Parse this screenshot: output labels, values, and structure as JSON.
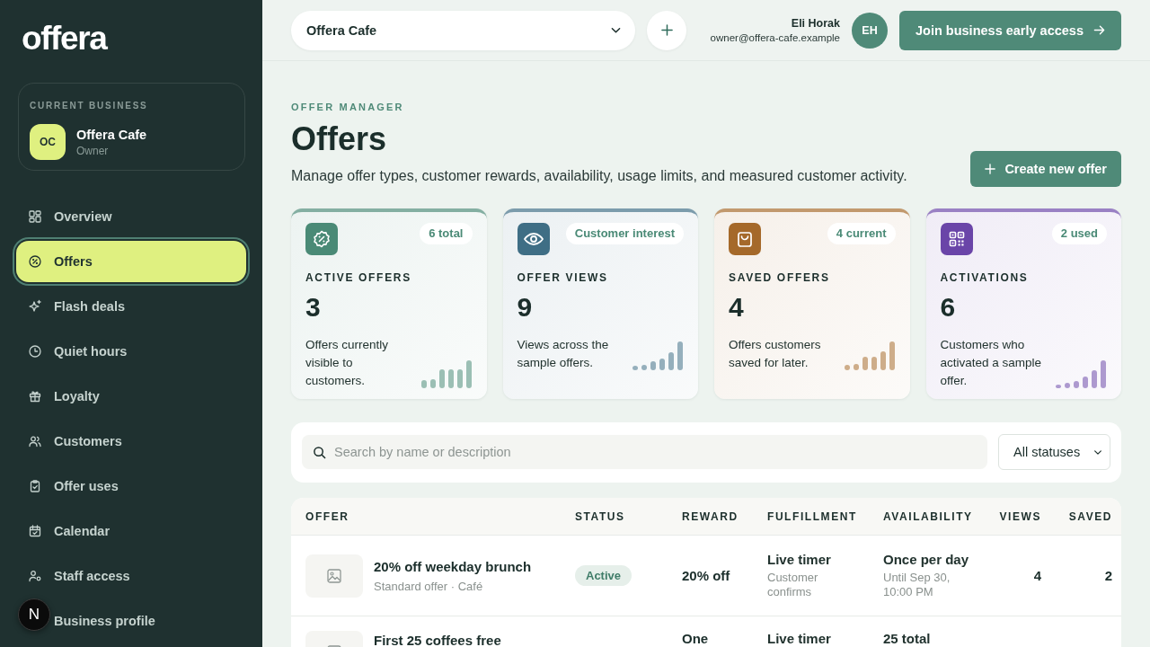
{
  "sidebar": {
    "logo": "offera",
    "business_card": {
      "caption": "CURRENT BUSINESS",
      "initials": "OC",
      "name": "Offera Cafe",
      "role": "Owner"
    },
    "nav": [
      {
        "label": "Overview",
        "selected": false
      },
      {
        "label": "Offers",
        "selected": true
      },
      {
        "label": "Flash deals",
        "selected": false
      },
      {
        "label": "Quiet hours",
        "selected": false
      },
      {
        "label": "Loyalty",
        "selected": false
      },
      {
        "label": "Customers",
        "selected": false
      },
      {
        "label": "Offer uses",
        "selected": false
      },
      {
        "label": "Calendar",
        "selected": false
      },
      {
        "label": "Staff access",
        "selected": false
      },
      {
        "label": "Business profile",
        "selected": false
      }
    ]
  },
  "dev_badge": {
    "label": "N"
  },
  "topbar": {
    "business_select": {
      "value": "Offera Cafe"
    },
    "user": {
      "name": "Eli Horak",
      "email": "owner@offera-cafe.example",
      "initials": "EH"
    },
    "cta": "Join business early access"
  },
  "header": {
    "eyebrow": "OFFER MANAGER",
    "title": "Offers",
    "description": "Manage offer types, customer rewards, availability, usage limits, and measured customer activity.",
    "create_button": "Create new offer"
  },
  "stats": [
    {
      "label": "ACTIVE OFFERS",
      "value": "3",
      "badge": "6 total",
      "description": "Offers currently visible to customers.",
      "color": "#4a8a76"
    },
    {
      "label": "OFFER VIEWS",
      "value": "9",
      "badge": "Customer interest",
      "description": "Views across the sample offers.",
      "color": "#3f6e85"
    },
    {
      "label": "SAVED OFFERS",
      "value": "4",
      "badge": "4 current",
      "description": "Offers customers saved for later.",
      "color": "#a5692a"
    },
    {
      "label": "ACTIVATIONS",
      "value": "6",
      "badge": "2 used",
      "description": "Customers who activated a sample offer.",
      "color": "#6a45a8"
    }
  ],
  "filters": {
    "search": {
      "placeholder": "Search by name or description"
    },
    "status_select": {
      "value": "All statuses"
    }
  },
  "table": {
    "columns": [
      "OFFER",
      "STATUS",
      "REWARD",
      "FULFILLMENT",
      "AVAILABILITY",
      "VIEWS",
      "SAVED"
    ],
    "rows": [
      {
        "title": "20% off weekday brunch",
        "subtitle": "Standard offer · Café",
        "status": "Active",
        "reward": "20% off",
        "fulfillment": "Live timer",
        "fulfillment_note": "Customer confirms",
        "availability": "Once per day",
        "availability_note": "Until Sep 30, 10:00 PM",
        "views": "4",
        "saved": "2"
      },
      {
        "title": "First 25 coffees free",
        "reward": "One",
        "fulfillment": "Live timer",
        "availability": "25 total"
      }
    ]
  }
}
